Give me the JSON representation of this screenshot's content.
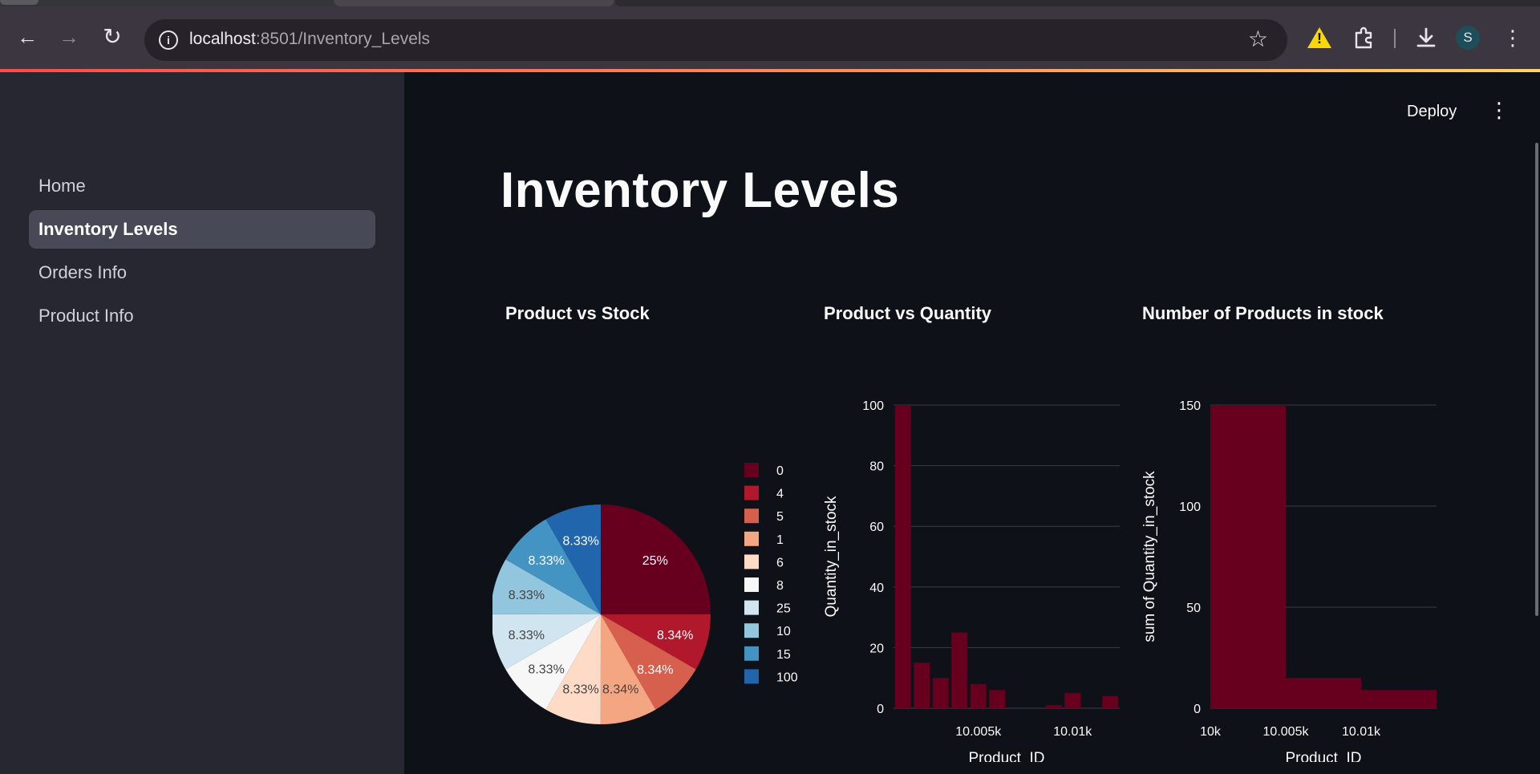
{
  "browser": {
    "url_host": "localhost",
    "url_path": ":8501/Inventory_Levels",
    "avatar_letter": "S"
  },
  "sidebar": {
    "items": [
      {
        "label": "Home"
      },
      {
        "label": "Inventory Levels"
      },
      {
        "label": "Orders Info"
      },
      {
        "label": "Product Info"
      }
    ]
  },
  "header": {
    "deploy_label": "Deploy"
  },
  "main": {
    "title": "Inventory Levels"
  },
  "charts": [
    {
      "title": "Product vs Stock"
    },
    {
      "title": "Product vs Quantity"
    },
    {
      "title": "Number of Products in stock"
    }
  ],
  "chart_data": [
    {
      "type": "pie",
      "title": "Product vs Stock",
      "legend_position": "right",
      "slices": [
        {
          "label": "0",
          "value": 25,
          "text": "25%",
          "color": "#67001f"
        },
        {
          "label": "4",
          "value": 8.34,
          "text": "8.34%",
          "color": "#b2182b"
        },
        {
          "label": "5",
          "value": 8.34,
          "text": "8.34%",
          "color": "#d6604d"
        },
        {
          "label": "1",
          "value": 8.34,
          "text": "8.34%",
          "color": "#f4a582"
        },
        {
          "label": "6",
          "value": 8.33,
          "text": "8.33%",
          "color": "#fddbc7"
        },
        {
          "label": "8",
          "value": 8.33,
          "text": "8.33%",
          "color": "#f7f7f7"
        },
        {
          "label": "25",
          "value": 8.33,
          "text": "8.33%",
          "color": "#d1e5f0"
        },
        {
          "label": "10",
          "value": 8.33,
          "text": "8.33%",
          "color": "#92c5de"
        },
        {
          "label": "15",
          "value": 8.33,
          "text": "8.33%",
          "color": "#4393c3"
        },
        {
          "label": "100",
          "value": 8.33,
          "text": "8.33%",
          "color": "#2166ac"
        }
      ]
    },
    {
      "type": "bar",
      "title": "Product vs Quantity",
      "xlabel": "Product_ID",
      "ylabel": "Quantity_in_stock",
      "ylim": [
        0,
        100
      ],
      "yticks": [
        "0",
        "20",
        "40",
        "60",
        "80",
        "100"
      ],
      "xticks": [
        {
          "value": 10005,
          "label": "10.005k"
        },
        {
          "value": 10010,
          "label": "10.01k"
        }
      ],
      "x": [
        10001,
        10002,
        10003,
        10004,
        10005,
        10006,
        10007,
        10008,
        10009,
        10010,
        10011,
        10012
      ],
      "values": [
        100,
        15,
        10,
        25,
        8,
        6,
        0,
        0,
        1,
        5,
        0,
        4
      ],
      "grid": true,
      "color": "#67001f"
    },
    {
      "type": "bar",
      "title": "Number of Products in stock",
      "xlabel": "Product_ID",
      "ylabel": "sum of Quantity_in_stock",
      "ylim": [
        0,
        150
      ],
      "yticks": [
        "0",
        "50",
        "100",
        "150"
      ],
      "xticks": [
        {
          "value": 10000,
          "label": "10k"
        },
        {
          "value": 10005,
          "label": "10.005k"
        },
        {
          "value": 10010,
          "label": "10.01k"
        }
      ],
      "bins": [
        {
          "start": 10000,
          "end": 10005,
          "value": 150
        },
        {
          "start": 10005,
          "end": 10010,
          "value": 15
        },
        {
          "start": 10010,
          "end": 10015,
          "value": 9
        }
      ],
      "grid": true,
      "color": "#67001f"
    }
  ]
}
